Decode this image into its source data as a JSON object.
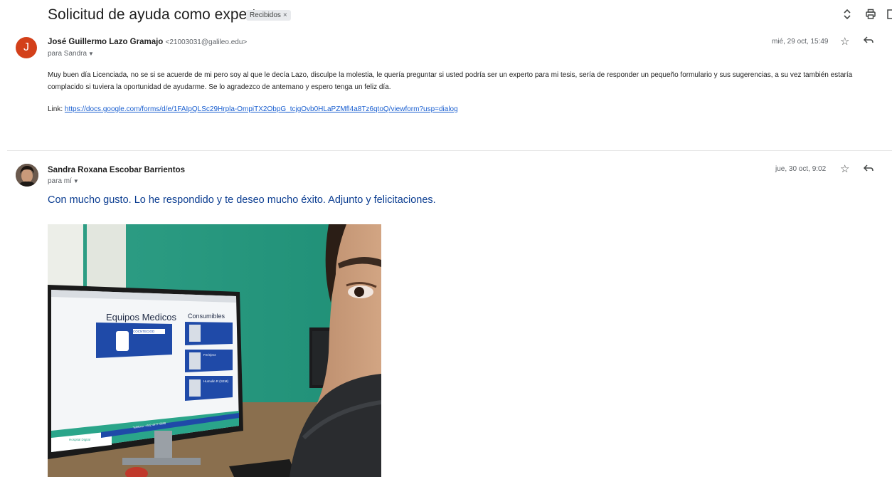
{
  "thread": {
    "subject": "Solicitud de ayuda como experto",
    "label": "Recibidos",
    "label_close": "×",
    "actions": {
      "expand_icon": "unfold-icon",
      "print_icon": "print-icon"
    }
  },
  "messages": [
    {
      "avatar_letter": "J",
      "sender_name": "José Guillermo Lazo Gramajo",
      "sender_email": "<21003031@galileo.edu>",
      "to": "para Sandra",
      "date": "mié, 29 oct, 15:49",
      "body": "Muy buen día Licenciada, no se si se acuerde de mi pero soy al que le decía Lazo, disculpe la molestia, le quería preguntar si usted podría ser un experto para mi tesis, sería de responder un pequeño formulario y sus sugerencias, a su vez también estaría complacido si tuviera la oportunidad de ayudarme. Se lo agradezco de antemano y espero tenga un feliz día.",
      "link_prefix": "Link: ",
      "link_text": "https://docs.google.com/forms/d/e/1FAIpQLSc29Hrpla-OmpiTX2ObpG_tcjgOvb0HLaPZMfl4a8Tz6qtoQ/viewform?usp=dialog"
    },
    {
      "sender_name": "Sandra Roxana Escobar Barrientos",
      "to": "para mí",
      "date": "jue, 30 oct, 9:02",
      "body": "Con mucho gusto. Lo he respondido y te deseo mucho éxito. Adjunto y felicitaciones.",
      "attachment": {
        "screen_left_title": "Equipos Medicos",
        "screen_right_title": "Consumibles",
        "screen_badge": "COCNTECIOD",
        "screen_item_2": "Ferinject",
        "screen_item_3": "Humulin R (SEM)",
        "screen_footer_phone": "Teléfono: +502 4477-5888",
        "screen_logo": "Hospital Digital"
      }
    }
  ]
}
